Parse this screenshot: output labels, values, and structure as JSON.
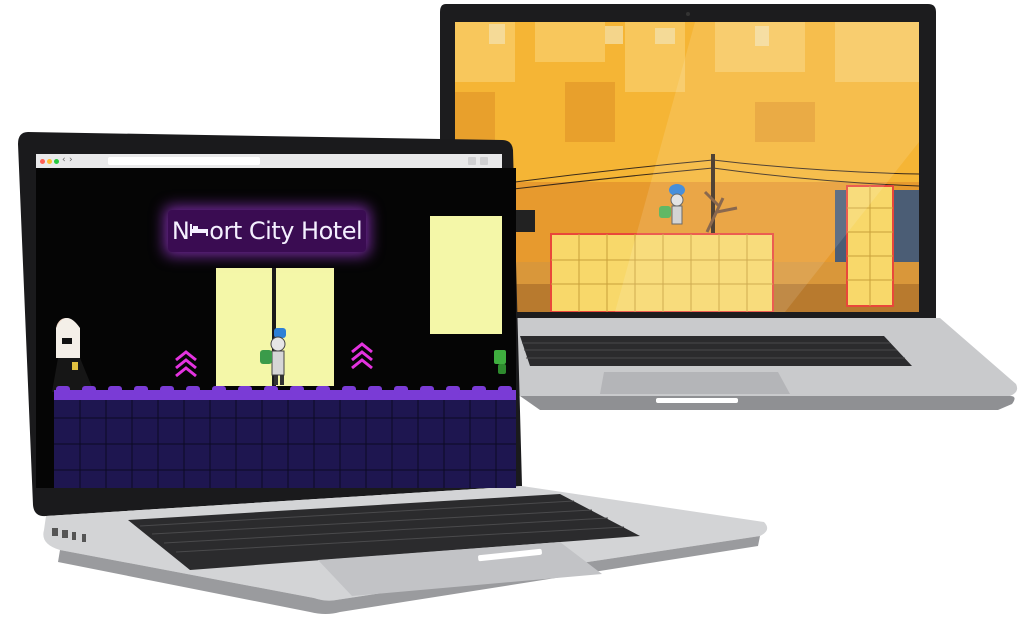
{
  "scene": {
    "background": "#ffffff"
  },
  "front_laptop": {
    "browser": {
      "nav_back": "‹",
      "nav_forward": "›"
    },
    "game": {
      "level_sign": "N",
      "level_sign_rest": "ort City Hotel",
      "sign_icon": "bed-icon",
      "background_color": "#050505",
      "floor_color": "#2a1a6e",
      "floor_top_color": "#7a3bd6",
      "window_color": "#f4f7a8",
      "jump_pad_color": "#e433e0"
    }
  },
  "back_laptop": {
    "game": {
      "sky_color": "#f5b535",
      "crate_color": "#f8d86a",
      "crate_border": "#e9473a",
      "ground_color": "#d9973a"
    }
  }
}
